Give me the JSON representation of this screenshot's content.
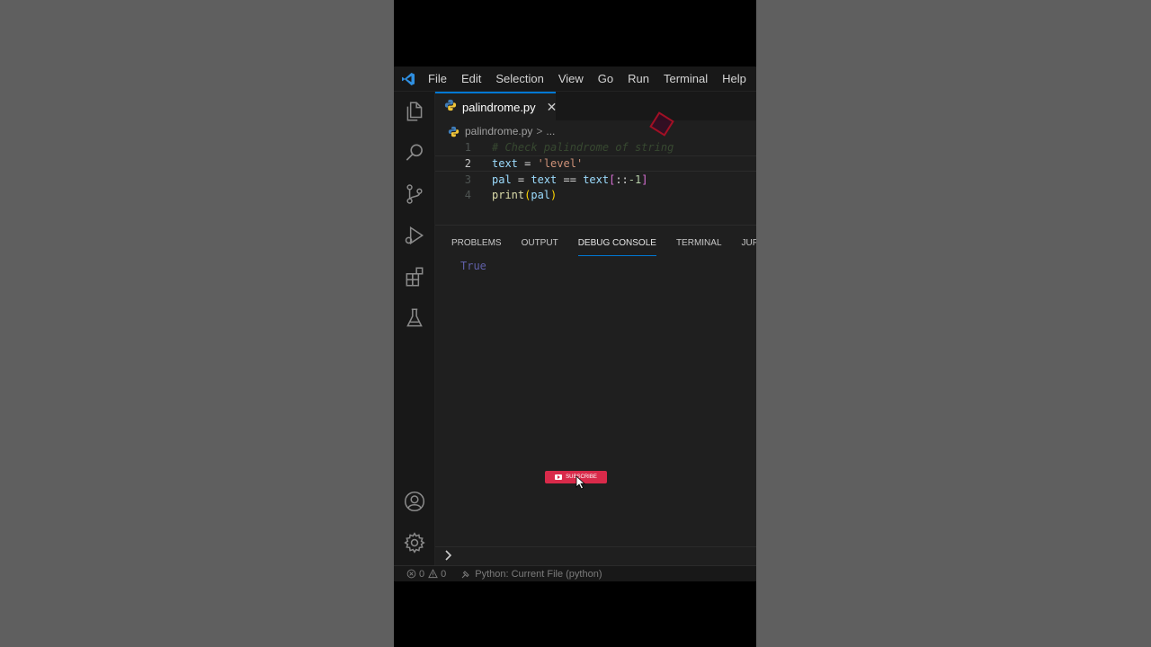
{
  "menu": {
    "items": [
      "File",
      "Edit",
      "Selection",
      "View",
      "Go",
      "Run",
      "Terminal",
      "Help"
    ]
  },
  "activity_bar": {
    "icons": [
      "files-icon",
      "search-icon",
      "source-control-icon",
      "run-debug-icon",
      "extensions-icon",
      "testing-icon",
      "account-icon",
      "settings-gear-icon"
    ]
  },
  "editor": {
    "tab_label": "palindrome.py",
    "tab_close": "✕",
    "breadcrumb": {
      "file": "palindrome.py",
      "separator": ">",
      "rest": "..."
    },
    "lines": [
      {
        "number": "1",
        "segments": [
          {
            "text": "# Check palindrome of string",
            "class": "cm"
          }
        ]
      },
      {
        "number": "2",
        "segments": [
          {
            "text": "text",
            "class": "var"
          },
          {
            "text": " = ",
            "class": "op"
          },
          {
            "text": "'level'",
            "class": "str"
          }
        ]
      },
      {
        "number": "3",
        "segments": [
          {
            "text": "pal",
            "class": "var"
          },
          {
            "text": " = ",
            "class": "op"
          },
          {
            "text": "text",
            "class": "var"
          },
          {
            "text": " == ",
            "class": "op"
          },
          {
            "text": "text",
            "class": "var"
          },
          {
            "text": "[",
            "class": "br2"
          },
          {
            "text": "::",
            "class": "op"
          },
          {
            "text": "-1",
            "class": "num"
          },
          {
            "text": "]",
            "class": "br2"
          }
        ]
      },
      {
        "number": "4",
        "segments": [
          {
            "text": "print",
            "class": "fn"
          },
          {
            "text": "(",
            "class": "br"
          },
          {
            "text": "pal",
            "class": "var"
          },
          {
            "text": ")",
            "class": "br"
          }
        ]
      }
    ]
  },
  "panel": {
    "tabs": [
      "PROBLEMS",
      "OUTPUT",
      "DEBUG CONSOLE",
      "TERMINAL",
      "JUPYTER"
    ],
    "active_tab": "DEBUG CONSOLE",
    "output": "True",
    "prompt": "›"
  },
  "overlay": {
    "subscribe_label": "SUBSCRIBE"
  },
  "status_bar": {
    "errors": "0",
    "warnings": "0",
    "run_config": "Python: Current File (python)"
  },
  "colors": {
    "accent": "#0078d4",
    "subscribe": "#d92a4a",
    "editor_bg": "#1f1f1f",
    "chrome_bg": "#181818"
  }
}
